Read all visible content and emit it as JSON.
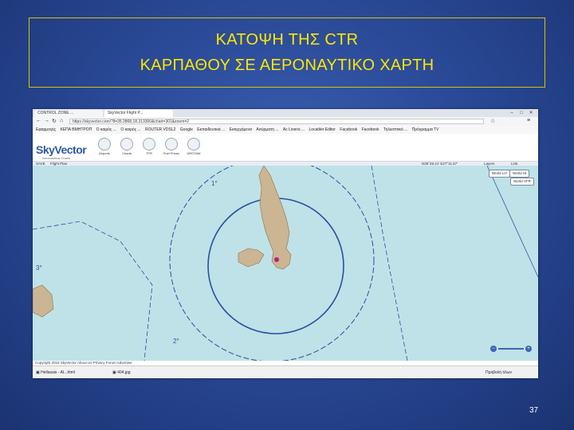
{
  "slide": {
    "title_line1": "ΚΑΤΟΨΗ ΤΗΣ CTR",
    "title_line2": "ΚΑΡΠΑΘΟΥ ΣΕ ΑΕΡΟΝΑΥΤΙΚΟ ΧΑΡΤΗ",
    "page_number": "37"
  },
  "browser": {
    "tabs": [
      "CONTROL ZONE ...",
      "SkyVector Flight P..."
    ],
    "window_controls": [
      "–",
      "□",
      "✕"
    ],
    "url": "https://skyvector.com/?ll=35.2868,18.313300&chart=301&zoom=2",
    "bookmarks": [
      "Εφαρμογές",
      "ΚΕΠΑ ΒΜΗΤΡΟΠ",
      "Ο καιρός ...",
      "Ο καιρός ...",
      "ROUTER VDSL2",
      "Google",
      "Εκπαιδευτικά ...",
      "Εισερχόμενα",
      "Ασύρματη ...",
      "Ac Liveris ...",
      "Locatiler Editor",
      "Facebook",
      "Facebook",
      "Τηλεοπτικό ...",
      "Πρόγραμμα TV"
    ]
  },
  "skyvector": {
    "logo": "SkyVector",
    "logo_sub": "Aeronautical Charts",
    "nav": [
      "Airports",
      "Charts",
      "TFR",
      "Fuel Prices",
      "DROTAM"
    ],
    "toolbar_left": [
      "SAVE",
      "Flight Plan"
    ],
    "toolbar_right": [
      "Layers",
      "Link"
    ],
    "coords": "N35°28.41' E27°11.57'",
    "map_buttons": [
      "World LO",
      "World HI",
      "World VFR"
    ],
    "chart_labels": [
      "1°",
      "3°",
      "2°"
    ],
    "attribution": "Copyright 2016 SkyVector About Us Privacy Forum Advertise"
  },
  "downloads": {
    "items": [
      "Hellasais - AI...html",
      "404.jpg"
    ],
    "show_all": "Προβολή όλων"
  },
  "colors": {
    "title": "#ffe600",
    "border": "#d8c400",
    "sea": "#bfe2e8",
    "land": "#cbb592",
    "ctr": "#2a4fa0"
  }
}
